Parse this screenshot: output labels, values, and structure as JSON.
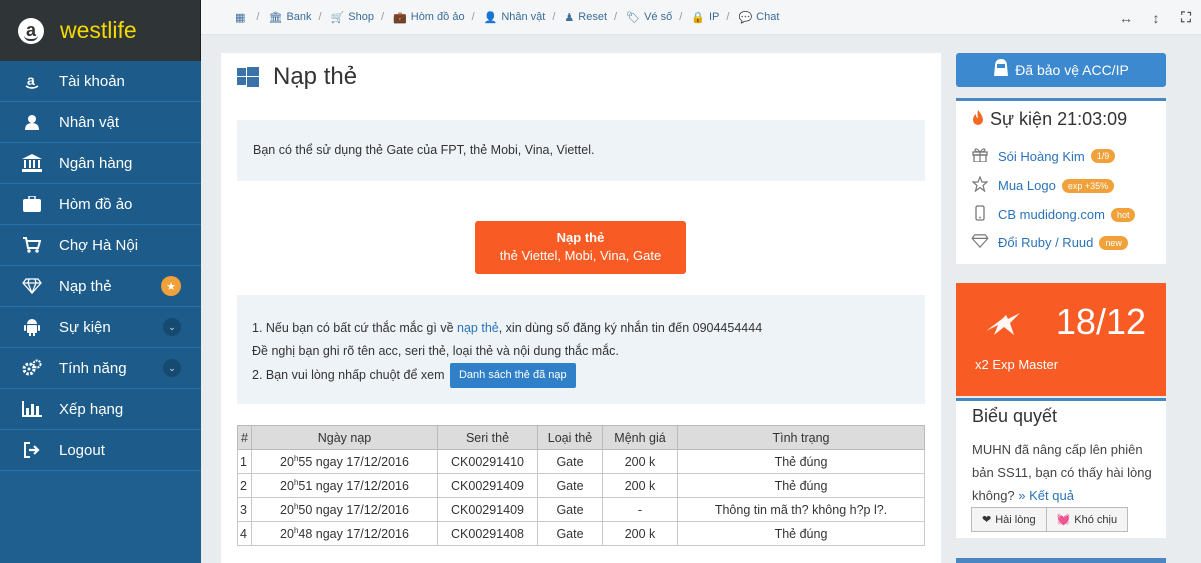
{
  "brand": {
    "name": "westlife",
    "icon": "a"
  },
  "sidebar": {
    "items": [
      {
        "label": "Tài khoản",
        "icon": "amazon-icon"
      },
      {
        "label": "Nhân vật",
        "icon": "user-icon"
      },
      {
        "label": "Ngân hàng",
        "icon": "bank-icon"
      },
      {
        "label": "Hòm đồ ảo",
        "icon": "briefcase-icon"
      },
      {
        "label": "Chợ Hà Nội",
        "icon": "cart-icon"
      },
      {
        "label": "Nạp thẻ",
        "icon": "diamond-icon",
        "badge": "★"
      },
      {
        "label": "Sự kiện",
        "icon": "android-icon",
        "badge": "⌄"
      },
      {
        "label": "Tính năng",
        "icon": "cogs-icon",
        "badge": "⌄"
      },
      {
        "label": "Xếp hạng",
        "icon": "bar-chart-icon"
      },
      {
        "label": "Logout",
        "icon": "sign-out-icon"
      }
    ]
  },
  "topnav": {
    "links": [
      {
        "label": "Bank",
        "icon": "🏛"
      },
      {
        "label": "Shop",
        "icon": "🛒"
      },
      {
        "label": "Hòm đồ ảo",
        "icon": "💼"
      },
      {
        "label": "Nhân vật",
        "icon": "👤"
      },
      {
        "label": "Reset",
        "icon": "♟"
      },
      {
        "label": "Vé số",
        "icon": "🏷"
      },
      {
        "label": "IP",
        "icon": "🔒"
      },
      {
        "label": "Chat",
        "icon": "💬"
      }
    ],
    "tools": [
      "↔",
      "↕",
      "⛶"
    ]
  },
  "main": {
    "title": "Nạp thẻ",
    "notice": "Bạn có thể sử dụng thẻ Gate của FPT, thẻ Mobi, Vina, Viettel.",
    "cta": {
      "line1": "Nạp thẻ",
      "line2": "thẻ Viettel, Mobi, Vina, Gate"
    },
    "info": {
      "line1_pre": "1. Nếu bạn có bất cứ thắc mắc gì về ",
      "line1_link": "nạp thẻ",
      "line1_post": ", xin dùng số đăng ký nhắn tin đến 0904454444",
      "line2": "Đề nghị bạn ghi rõ tên acc, seri thẻ, loại thẻ và nội dung thắc mắc.",
      "line3": "2. Bạn vui lòng nhấp chuột để xem",
      "button": "Danh sách thẻ đã nạp"
    },
    "table": {
      "headers": [
        "#",
        "Ngày nạp",
        "Seri thẻ",
        "Loại thẻ",
        "Mệnh giá",
        "Tình trạng"
      ],
      "rows": [
        {
          "idx": "1",
          "hour": "20",
          "min": "h",
          "rest": "55 ngay 17/12/2016",
          "serial": "CK00291410",
          "type": "Gate",
          "value": "200 k",
          "status": "Thẻ đúng"
        },
        {
          "idx": "2",
          "hour": "20",
          "min": "h",
          "rest": "51 ngay 17/12/2016",
          "serial": "CK00291409",
          "type": "Gate",
          "value": "200 k",
          "status": "Thẻ đúng"
        },
        {
          "idx": "3",
          "hour": "20",
          "min": "h",
          "rest": "50 ngay 17/12/2016",
          "serial": "CK00291409",
          "type": "Gate",
          "value": "-",
          "status": "Thông tin mã th? không h?p l?."
        },
        {
          "idx": "4",
          "hour": "20",
          "min": "h",
          "rest": "48 ngay 17/12/2016",
          "serial": "CK00291408",
          "type": "Gate",
          "value": "200 k",
          "status": "Thẻ đúng"
        }
      ]
    }
  },
  "right": {
    "protect": "Đã bảo vệ ACC/IP",
    "event_title": "Sự kiện 21:03:09",
    "events": [
      {
        "label": "Sói Hoàng Kim",
        "tag": "1/9",
        "icon": "gift-icon"
      },
      {
        "label": "Mua Logo",
        "tag": "exp +35%",
        "icon": "star-icon"
      },
      {
        "label": "CB mudidong.com",
        "tag": "hot",
        "icon": "mobile-icon"
      },
      {
        "label": "Đổi Ruby / Ruud",
        "tag": "new",
        "icon": "diamond-icon"
      }
    ],
    "promo": {
      "date": "18/12",
      "text": "x2 Exp Master"
    },
    "vote": {
      "title": "Biểu quyết",
      "text": "MUHN đã nâng cấp lên phiên bản SS11, bạn có thấy hài lòng không?",
      "link": "» Kết quả",
      "btn_yes": "Hài lòng",
      "btn_no": "Khó chịu"
    }
  },
  "colors": {
    "sidebar": "#1f5f8f",
    "brand_bg": "#2f3436",
    "accent_orange": "#f85c24",
    "link_blue": "#2a72b8",
    "badge": "#f0a13a"
  }
}
